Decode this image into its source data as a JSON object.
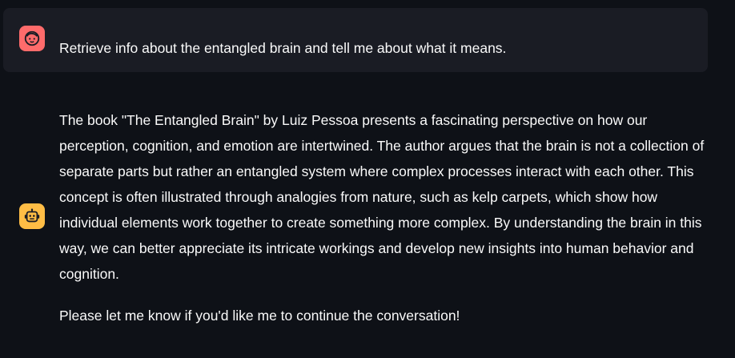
{
  "chat": {
    "user_message": {
      "avatar_icon": "user-face-icon",
      "avatar_color": "#ff6b6b",
      "text": "Retrieve info about the entangled brain and tell me about what it means."
    },
    "assistant_message": {
      "avatar_icon": "robot-icon",
      "avatar_color": "#ffbd45",
      "paragraphs": [
        "The book \"The Entangled Brain\" by Luiz Pessoa presents a fascinating perspective on how our perception, cognition, and emotion are intertwined. The author argues that the brain is not a collection of separate parts but rather an entangled system where complex processes interact with each other. This concept is often illustrated through analogies from nature, such as kelp carpets, which show how individual elements work together to create something more complex. By understanding the brain in this way, we can better appreciate its intricate workings and develop new insights into human behavior and cognition.",
        "Please let me know if you'd like me to continue the conversation!"
      ]
    }
  }
}
